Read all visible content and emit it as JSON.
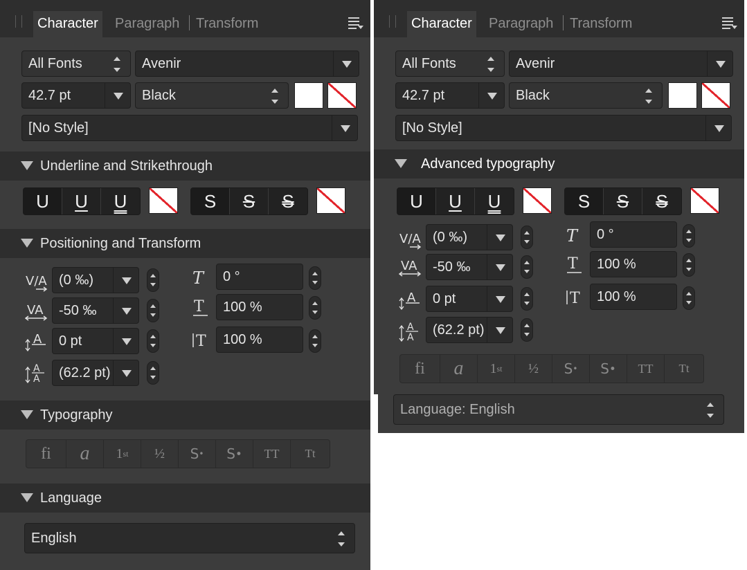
{
  "tabs": {
    "character": "Character",
    "paragraph": "Paragraph",
    "transform": "Transform"
  },
  "font": {
    "collection": "All Fonts",
    "family": "Avenir",
    "size": "42.7 pt",
    "weight": "Black",
    "style": "[No Style]"
  },
  "sections": {
    "underline": "Underline and Strikethrough",
    "advanced": "Advanced typography",
    "positioning": "Positioning and Transform",
    "typography": "Typography",
    "language": "Language"
  },
  "decoration_buttons": {
    "u1": "U",
    "u2": "U",
    "u3": "U",
    "s1": "S",
    "s2": "S",
    "s3": "S"
  },
  "positioning": {
    "kerning": "(0 ‰)",
    "tracking": "-50 ‰",
    "baseline": "0 pt",
    "leading": "(62.2 pt)",
    "shear": "0 °",
    "horiz_scale": "100 %",
    "vert_scale": "100 %"
  },
  "typography_buttons": {
    "ligatures": "fi",
    "swash": "a",
    "ordinal": "1st",
    "fraction": "½",
    "superscript": "S",
    "subscript": "S",
    "allcaps": "TT",
    "smallcaps": "Tt"
  },
  "language": {
    "value_a": "English",
    "value_b": "Language: English"
  },
  "colors": {
    "panel": "#3c3c3c",
    "header": "#2e2e2e",
    "field": "#2b2b2b",
    "no_fill_slash": "#e2232a"
  }
}
